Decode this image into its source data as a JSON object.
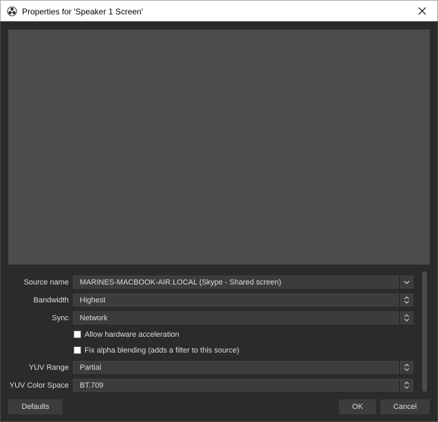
{
  "window": {
    "title": "Properties for 'Speaker 1 Screen'"
  },
  "form": {
    "source_name": {
      "label": "Source name",
      "value": "MARINES-MACBOOK-AIR.LOCAL (Skype - Shared screen)"
    },
    "bandwidth": {
      "label": "Bandwidth",
      "value": "Highest"
    },
    "sync": {
      "label": "Sync",
      "value": "Network"
    },
    "hw_accel": {
      "label": "Allow hardware acceleration",
      "checked": false
    },
    "fix_alpha": {
      "label": "Fix alpha blending (adds a filter to this source)",
      "checked": false
    },
    "yuv_range": {
      "label": "YUV Range",
      "value": "Partial"
    },
    "yuv_color_space": {
      "label": "YUV Color Space",
      "value": "BT.709"
    }
  },
  "buttons": {
    "defaults": "Defaults",
    "ok": "OK",
    "cancel": "Cancel"
  },
  "icons": {
    "app": "obs-logo-icon",
    "close": "close-icon",
    "dropdown": "chevron-down-icon",
    "spinner": "up-down-arrows-icon"
  },
  "colors": {
    "background": "#2b2b2b",
    "preview": "#4c4c4c",
    "field": "#3c3c3c",
    "text": "#dcdcdc"
  }
}
